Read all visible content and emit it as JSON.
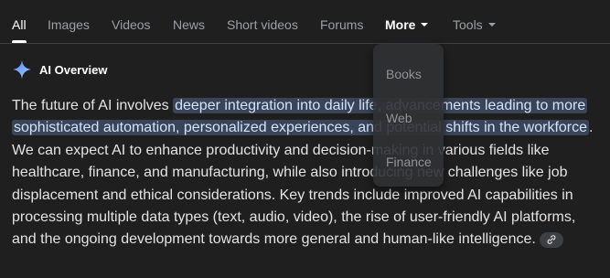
{
  "tabs": [
    {
      "label": "All",
      "active": true
    },
    {
      "label": "Images"
    },
    {
      "label": "Videos"
    },
    {
      "label": "News"
    },
    {
      "label": "Short videos"
    },
    {
      "label": "Forums"
    },
    {
      "label": "More",
      "expanded": true
    },
    {
      "label": "Tools"
    }
  ],
  "ai_overview": {
    "title": "AI Overview",
    "icon": "sparkle-icon",
    "text_part1": "The future of AI involves ",
    "text_highlight": "deeper integration into daily life, advancements leading to more sophisticated automation, personalized experiences, and potential shifts in the workforce",
    "text_part2": ". We can expect AI to enhance productivity and decision-making in various fields like healthcare, finance, and manufacturing, while also introducing new challenges like job displacement and ethical considerations. Key trends include improved AI capabilities in processing multiple data types (text, audio, video), the rise of user-friendly AI platforms, and the ongoing development towards more general and human-like intelligence.",
    "link_icon": "link-icon"
  },
  "more_menu": {
    "items": [
      "Books",
      "Web",
      "Finance"
    ]
  },
  "colors": {
    "background": "#1f1f1f",
    "highlight_bg": "#394457",
    "highlight_text": "#d2e3fc",
    "tab_inactive": "#9aa0a6",
    "tab_active": "#ffffff"
  }
}
